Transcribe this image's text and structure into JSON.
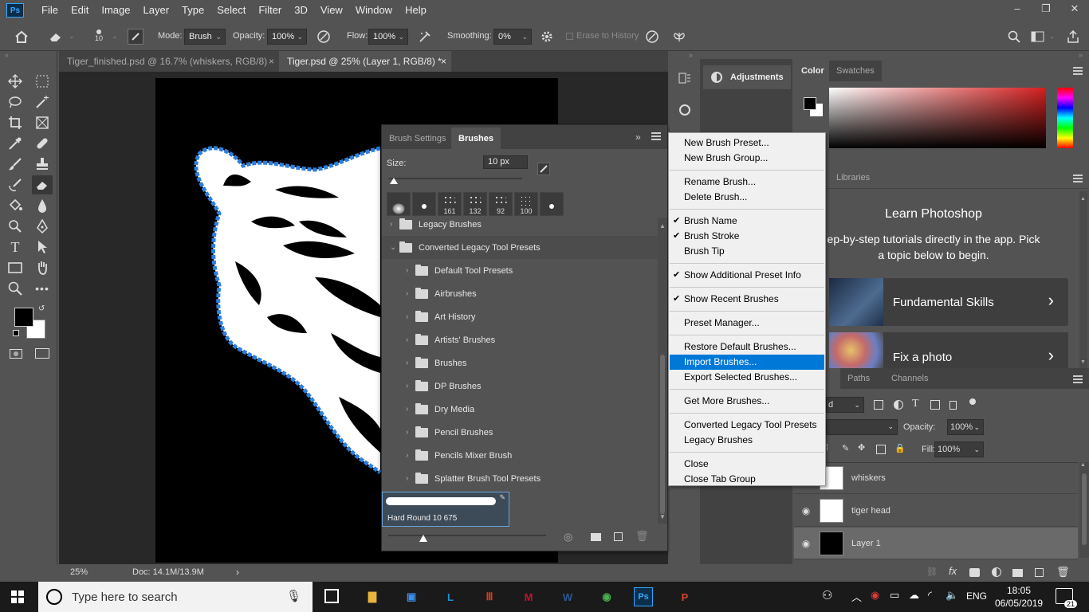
{
  "app": {
    "logo": "Ps",
    "menu": [
      "File",
      "Edit",
      "Image",
      "Layer",
      "Type",
      "Select",
      "Filter",
      "3D",
      "View",
      "Window",
      "Help"
    ],
    "win_controls": [
      "–",
      "❐",
      "✕"
    ]
  },
  "options": {
    "brush_size": "10",
    "mode_label": "Mode:",
    "mode_value": "Brush",
    "opacity_label": "Opacity:",
    "opacity_value": "100%",
    "flow_label": "Flow:",
    "flow_value": "100%",
    "smoothing_label": "Smoothing:",
    "smoothing_value": "0%",
    "erase_to_history": "Erase to History"
  },
  "tabs": [
    {
      "label": "Tiger_finished.psd @ 16.7% (whiskers, RGB/8)",
      "close": "×"
    },
    {
      "label": "Tiger.psd @ 25% (Layer 1, RGB/8) *",
      "close": "×"
    }
  ],
  "status": {
    "zoom": "25%",
    "doc": "Doc: 14.1M/13.9M",
    "arrow": "›"
  },
  "brush_panel": {
    "tabs": [
      "Brush Settings",
      "Brushes"
    ],
    "size_label": "Size:",
    "size_value": "10 px",
    "recent": [
      {
        "n": ""
      },
      {
        "n": ""
      },
      {
        "n": "161"
      },
      {
        "n": "132"
      },
      {
        "n": "92"
      },
      {
        "n": "100"
      },
      {
        "n": ""
      }
    ],
    "groups": [
      {
        "label": "Legacy Brushes",
        "chev": "›"
      },
      {
        "label": "Converted Legacy Tool Presets",
        "chev": "⌄"
      },
      {
        "label": "Default Tool Presets",
        "chev": "›"
      },
      {
        "label": "Airbrushes",
        "chev": "›"
      },
      {
        "label": "Art History",
        "chev": "›"
      },
      {
        "label": "Artists' Brushes",
        "chev": "›"
      },
      {
        "label": "Brushes",
        "chev": "›"
      },
      {
        "label": "DP Brushes",
        "chev": "›"
      },
      {
        "label": "Dry Media",
        "chev": "›"
      },
      {
        "label": "Pencil Brushes",
        "chev": "›"
      },
      {
        "label": "Pencils Mixer Brush",
        "chev": "›"
      },
      {
        "label": "Splatter Brush Tool Presets",
        "chev": "›"
      }
    ],
    "selected_brush": "Hard Round 10 675"
  },
  "context_menu": {
    "check": "✔",
    "items": [
      {
        "label": "New Brush Preset...",
        "checked": false
      },
      {
        "label": "New Brush Group...",
        "checked": false
      },
      {
        "label": "Rename Brush...",
        "checked": false
      },
      {
        "label": "Delete Brush...",
        "checked": false
      },
      {
        "label": "Brush Name",
        "checked": true
      },
      {
        "label": "Brush Stroke",
        "checked": true
      },
      {
        "label": "Brush Tip",
        "checked": false
      },
      {
        "label": "Show Additional Preset Info",
        "checked": true
      },
      {
        "label": "Show Recent Brushes",
        "checked": true
      },
      {
        "label": "Preset Manager...",
        "checked": false
      },
      {
        "label": "Restore Default Brushes...",
        "checked": false
      },
      {
        "label": "Import Brushes...",
        "checked": false,
        "highlighted": true
      },
      {
        "label": "Export Selected Brushes...",
        "checked": false
      },
      {
        "label": "Get More Brushes...",
        "checked": false
      },
      {
        "label": "Converted Legacy Tool Presets",
        "checked": false
      },
      {
        "label": "Legacy Brushes",
        "checked": false
      },
      {
        "label": "Close",
        "checked": false
      },
      {
        "label": "Close Tab Group",
        "checked": false
      }
    ]
  },
  "adjustments": {
    "label": "Adjustments"
  },
  "color_panel": {
    "tabs": [
      "Color",
      "Swatches"
    ]
  },
  "learn_panel": {
    "tab": "Libraries",
    "title": "Learn Photoshop",
    "desc": "ep-by-step tutorials directly in the app. Pick a topic below to begin.",
    "cards": [
      {
        "label": "Fundamental Skills",
        "chev": "›"
      },
      {
        "label": "Fix a photo",
        "chev": "›"
      }
    ]
  },
  "layers_panel": {
    "tabs": [
      "Paths",
      "Channels"
    ],
    "kind_value": "d",
    "opacity_label": "Opacity:",
    "opacity_value": "100%",
    "fill_label": "Fill:",
    "fill_value": "100%",
    "layers": [
      {
        "name": "whiskers",
        "visible": false
      },
      {
        "name": "tiger head",
        "visible": true
      },
      {
        "name": "Layer 1",
        "visible": true
      }
    ]
  },
  "taskbar": {
    "search_placeholder": "Type here to search",
    "lang": "ENG",
    "time": "18:05",
    "date": "06/05/2019",
    "notifications": "21",
    "apps": [
      {
        "name": "file-explorer-icon",
        "glyph": "▇",
        "color": "#e8b53a"
      },
      {
        "name": "store-icon",
        "glyph": "▣",
        "color": "#3a8ee6"
      },
      {
        "name": "l-app-icon",
        "glyph": "L",
        "color": "#1e90d6"
      },
      {
        "name": "red-app-icon",
        "glyph": "Ⅲ",
        "color": "#e03a1e"
      },
      {
        "name": "mcafee-icon",
        "glyph": "M",
        "color": "#c8102e"
      },
      {
        "name": "word-icon",
        "glyph": "W",
        "color": "#2b579a"
      },
      {
        "name": "chrome-icon",
        "glyph": "◉",
        "color": "#4caf50"
      },
      {
        "name": "photoshop-icon",
        "glyph": "Ps",
        "color": "#31a8ff"
      },
      {
        "name": "powerpoint-icon",
        "glyph": "P",
        "color": "#d24726"
      }
    ]
  }
}
